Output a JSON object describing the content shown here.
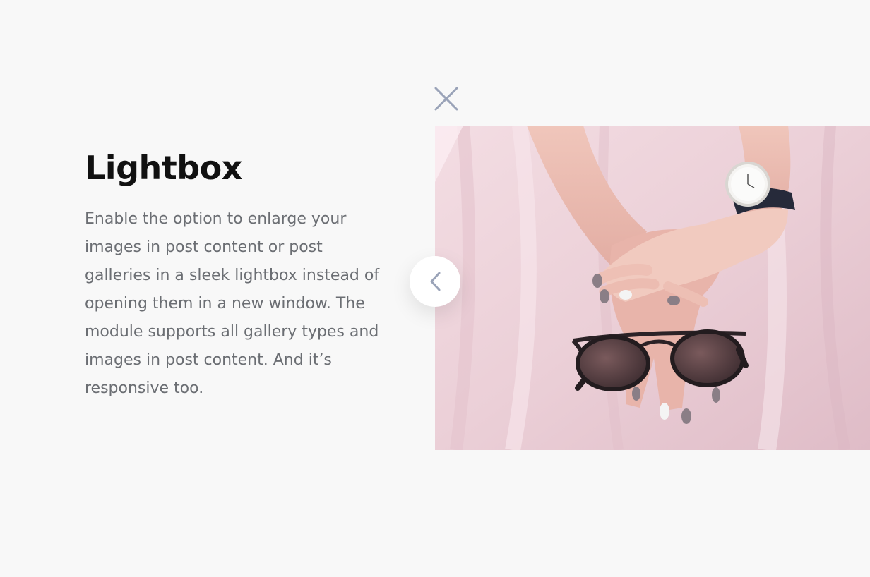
{
  "feature": {
    "title": "Lightbox",
    "description": "Enable the option to enlarge your images in post content or post galleries in a sleek lightbox instead of opening them in a new window. The module supports all gallery types and images in post content. And it’s responsive too."
  },
  "lightbox": {
    "close_icon": "close-icon",
    "prev_icon": "chevron-left-icon",
    "image_subject": "hands-with-sunglasses-and-watch-photo"
  },
  "colors": {
    "background": "#f8f8f8",
    "heading": "#111111",
    "body_text": "#6b6e73",
    "icon": "#9aa3b8"
  }
}
